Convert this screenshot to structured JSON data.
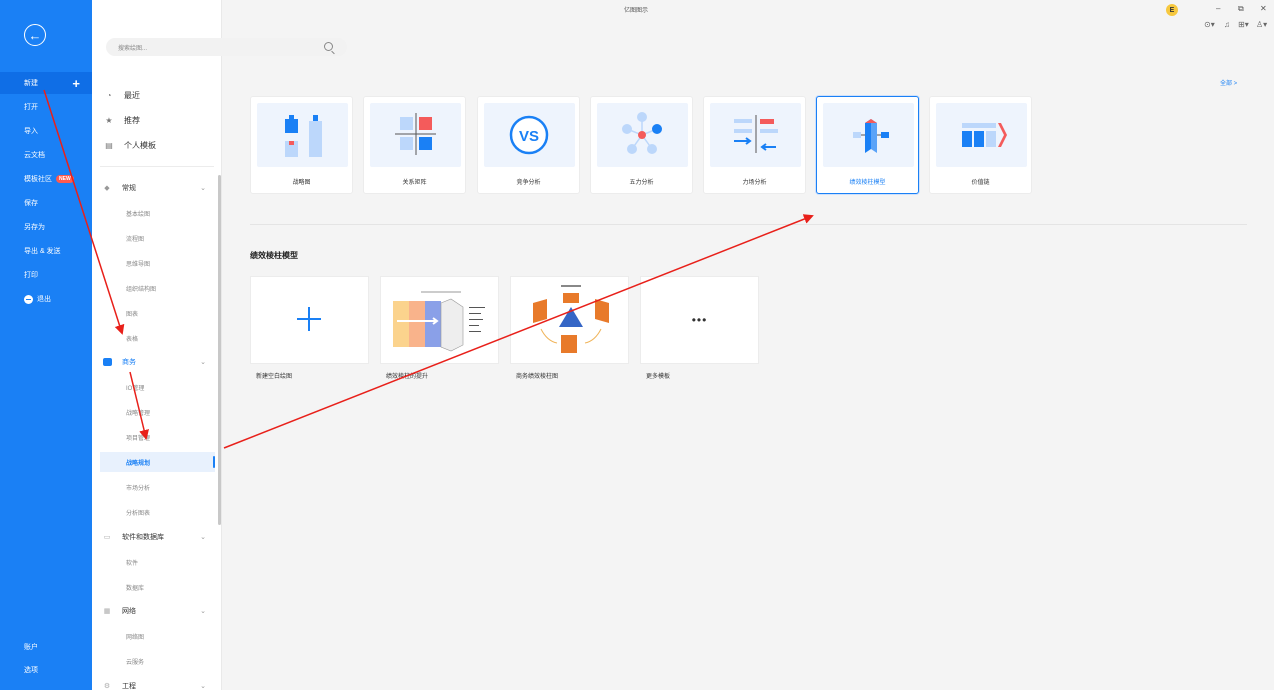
{
  "rail": {
    "items": [
      {
        "label": "新建"
      },
      {
        "label": "打开"
      },
      {
        "label": "导入"
      },
      {
        "label": "云文档"
      },
      {
        "label": "模板社区",
        "badge": "NEW"
      },
      {
        "label": "保存"
      },
      {
        "label": "另存为"
      },
      {
        "label": "导出 & 发送"
      },
      {
        "label": "打印"
      },
      {
        "label": "退出"
      }
    ],
    "bottom": [
      {
        "label": "账户"
      },
      {
        "label": "选项"
      }
    ]
  },
  "search": {
    "placeholder": "搜索绘图..."
  },
  "titlebar": {
    "title": "亿图图示",
    "user_initial": "E"
  },
  "categories": {
    "top": [
      {
        "label": "最近"
      },
      {
        "label": "推荐"
      },
      {
        "label": "个人模板"
      }
    ],
    "groups": [
      {
        "label": "常规",
        "subs": [
          "基本绘图",
          "流程图",
          "思维导图",
          "组织结构图",
          "图表",
          "表格"
        ]
      },
      {
        "label": "商务",
        "subs": [
          "IO管理",
          "战略管理",
          "项目管理",
          "战略规划",
          "市场分析",
          "分析图表"
        ]
      },
      {
        "label": "软件和数据库",
        "subs": [
          "软件",
          "数据库"
        ]
      },
      {
        "label": "网络",
        "subs": [
          "网络图",
          "云服务"
        ]
      },
      {
        "label": "工程",
        "subs": []
      }
    ]
  },
  "content": {
    "see_all": "全部 >",
    "templates": [
      {
        "label": "战略图"
      },
      {
        "label": "关系矩阵"
      },
      {
        "label": "竞争分析"
      },
      {
        "label": "五力分析"
      },
      {
        "label": "力场分析"
      },
      {
        "label": "绩效棱柱模型"
      },
      {
        "label": "价值链"
      }
    ],
    "section_title": "绩效棱柱模型",
    "examples": [
      {
        "label": "新建空白绘图"
      },
      {
        "label": "绩效棱柱的提升"
      },
      {
        "label": "商务绩效棱柱图"
      },
      {
        "label": "更多模板"
      }
    ]
  },
  "colors": {
    "accent": "#1a80f5",
    "rail": "#1a80f5",
    "annotation": "#e8201a"
  }
}
